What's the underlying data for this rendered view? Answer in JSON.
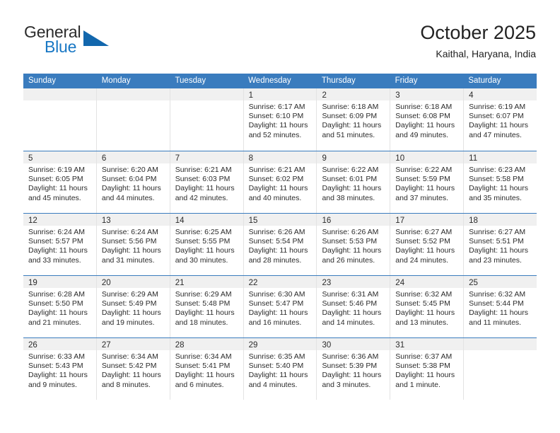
{
  "brand": {
    "name_part1": "General",
    "name_part2": "Blue",
    "triangle_color": "#1267ad",
    "blue_color": "#1877c4"
  },
  "header": {
    "title": "October 2025",
    "subtitle": "Kaithal, Haryana, India"
  },
  "theme": {
    "header_row_bg": "#3a7cbe",
    "daynum_strip_bg": "#f0f0f0",
    "cell_border": "#e3e3e3",
    "week_separator": "#3a7cbe"
  },
  "day_headers": [
    "Sunday",
    "Monday",
    "Tuesday",
    "Wednesday",
    "Thursday",
    "Friday",
    "Saturday"
  ],
  "weeks": [
    [
      {
        "day": "",
        "empty": true,
        "sunrise": "",
        "sunset": "",
        "daylight1": "",
        "daylight2": ""
      },
      {
        "day": "",
        "empty": true,
        "sunrise": "",
        "sunset": "",
        "daylight1": "",
        "daylight2": ""
      },
      {
        "day": "",
        "empty": true,
        "sunrise": "",
        "sunset": "",
        "daylight1": "",
        "daylight2": ""
      },
      {
        "day": "1",
        "empty": false,
        "sunrise": "Sunrise: 6:17 AM",
        "sunset": "Sunset: 6:10 PM",
        "daylight1": "Daylight: 11 hours",
        "daylight2": "and 52 minutes."
      },
      {
        "day": "2",
        "empty": false,
        "sunrise": "Sunrise: 6:18 AM",
        "sunset": "Sunset: 6:09 PM",
        "daylight1": "Daylight: 11 hours",
        "daylight2": "and 51 minutes."
      },
      {
        "day": "3",
        "empty": false,
        "sunrise": "Sunrise: 6:18 AM",
        "sunset": "Sunset: 6:08 PM",
        "daylight1": "Daylight: 11 hours",
        "daylight2": "and 49 minutes."
      },
      {
        "day": "4",
        "empty": false,
        "sunrise": "Sunrise: 6:19 AM",
        "sunset": "Sunset: 6:07 PM",
        "daylight1": "Daylight: 11 hours",
        "daylight2": "and 47 minutes."
      }
    ],
    [
      {
        "day": "5",
        "empty": false,
        "sunrise": "Sunrise: 6:19 AM",
        "sunset": "Sunset: 6:05 PM",
        "daylight1": "Daylight: 11 hours",
        "daylight2": "and 45 minutes."
      },
      {
        "day": "6",
        "empty": false,
        "sunrise": "Sunrise: 6:20 AM",
        "sunset": "Sunset: 6:04 PM",
        "daylight1": "Daylight: 11 hours",
        "daylight2": "and 44 minutes."
      },
      {
        "day": "7",
        "empty": false,
        "sunrise": "Sunrise: 6:21 AM",
        "sunset": "Sunset: 6:03 PM",
        "daylight1": "Daylight: 11 hours",
        "daylight2": "and 42 minutes."
      },
      {
        "day": "8",
        "empty": false,
        "sunrise": "Sunrise: 6:21 AM",
        "sunset": "Sunset: 6:02 PM",
        "daylight1": "Daylight: 11 hours",
        "daylight2": "and 40 minutes."
      },
      {
        "day": "9",
        "empty": false,
        "sunrise": "Sunrise: 6:22 AM",
        "sunset": "Sunset: 6:01 PM",
        "daylight1": "Daylight: 11 hours",
        "daylight2": "and 38 minutes."
      },
      {
        "day": "10",
        "empty": false,
        "sunrise": "Sunrise: 6:22 AM",
        "sunset": "Sunset: 5:59 PM",
        "daylight1": "Daylight: 11 hours",
        "daylight2": "and 37 minutes."
      },
      {
        "day": "11",
        "empty": false,
        "sunrise": "Sunrise: 6:23 AM",
        "sunset": "Sunset: 5:58 PM",
        "daylight1": "Daylight: 11 hours",
        "daylight2": "and 35 minutes."
      }
    ],
    [
      {
        "day": "12",
        "empty": false,
        "sunrise": "Sunrise: 6:24 AM",
        "sunset": "Sunset: 5:57 PM",
        "daylight1": "Daylight: 11 hours",
        "daylight2": "and 33 minutes."
      },
      {
        "day": "13",
        "empty": false,
        "sunrise": "Sunrise: 6:24 AM",
        "sunset": "Sunset: 5:56 PM",
        "daylight1": "Daylight: 11 hours",
        "daylight2": "and 31 minutes."
      },
      {
        "day": "14",
        "empty": false,
        "sunrise": "Sunrise: 6:25 AM",
        "sunset": "Sunset: 5:55 PM",
        "daylight1": "Daylight: 11 hours",
        "daylight2": "and 30 minutes."
      },
      {
        "day": "15",
        "empty": false,
        "sunrise": "Sunrise: 6:26 AM",
        "sunset": "Sunset: 5:54 PM",
        "daylight1": "Daylight: 11 hours",
        "daylight2": "and 28 minutes."
      },
      {
        "day": "16",
        "empty": false,
        "sunrise": "Sunrise: 6:26 AM",
        "sunset": "Sunset: 5:53 PM",
        "daylight1": "Daylight: 11 hours",
        "daylight2": "and 26 minutes."
      },
      {
        "day": "17",
        "empty": false,
        "sunrise": "Sunrise: 6:27 AM",
        "sunset": "Sunset: 5:52 PM",
        "daylight1": "Daylight: 11 hours",
        "daylight2": "and 24 minutes."
      },
      {
        "day": "18",
        "empty": false,
        "sunrise": "Sunrise: 6:27 AM",
        "sunset": "Sunset: 5:51 PM",
        "daylight1": "Daylight: 11 hours",
        "daylight2": "and 23 minutes."
      }
    ],
    [
      {
        "day": "19",
        "empty": false,
        "sunrise": "Sunrise: 6:28 AM",
        "sunset": "Sunset: 5:50 PM",
        "daylight1": "Daylight: 11 hours",
        "daylight2": "and 21 minutes."
      },
      {
        "day": "20",
        "empty": false,
        "sunrise": "Sunrise: 6:29 AM",
        "sunset": "Sunset: 5:49 PM",
        "daylight1": "Daylight: 11 hours",
        "daylight2": "and 19 minutes."
      },
      {
        "day": "21",
        "empty": false,
        "sunrise": "Sunrise: 6:29 AM",
        "sunset": "Sunset: 5:48 PM",
        "daylight1": "Daylight: 11 hours",
        "daylight2": "and 18 minutes."
      },
      {
        "day": "22",
        "empty": false,
        "sunrise": "Sunrise: 6:30 AM",
        "sunset": "Sunset: 5:47 PM",
        "daylight1": "Daylight: 11 hours",
        "daylight2": "and 16 minutes."
      },
      {
        "day": "23",
        "empty": false,
        "sunrise": "Sunrise: 6:31 AM",
        "sunset": "Sunset: 5:46 PM",
        "daylight1": "Daylight: 11 hours",
        "daylight2": "and 14 minutes."
      },
      {
        "day": "24",
        "empty": false,
        "sunrise": "Sunrise: 6:32 AM",
        "sunset": "Sunset: 5:45 PM",
        "daylight1": "Daylight: 11 hours",
        "daylight2": "and 13 minutes."
      },
      {
        "day": "25",
        "empty": false,
        "sunrise": "Sunrise: 6:32 AM",
        "sunset": "Sunset: 5:44 PM",
        "daylight1": "Daylight: 11 hours",
        "daylight2": "and 11 minutes."
      }
    ],
    [
      {
        "day": "26",
        "empty": false,
        "sunrise": "Sunrise: 6:33 AM",
        "sunset": "Sunset: 5:43 PM",
        "daylight1": "Daylight: 11 hours",
        "daylight2": "and 9 minutes."
      },
      {
        "day": "27",
        "empty": false,
        "sunrise": "Sunrise: 6:34 AM",
        "sunset": "Sunset: 5:42 PM",
        "daylight1": "Daylight: 11 hours",
        "daylight2": "and 8 minutes."
      },
      {
        "day": "28",
        "empty": false,
        "sunrise": "Sunrise: 6:34 AM",
        "sunset": "Sunset: 5:41 PM",
        "daylight1": "Daylight: 11 hours",
        "daylight2": "and 6 minutes."
      },
      {
        "day": "29",
        "empty": false,
        "sunrise": "Sunrise: 6:35 AM",
        "sunset": "Sunset: 5:40 PM",
        "daylight1": "Daylight: 11 hours",
        "daylight2": "and 4 minutes."
      },
      {
        "day": "30",
        "empty": false,
        "sunrise": "Sunrise: 6:36 AM",
        "sunset": "Sunset: 5:39 PM",
        "daylight1": "Daylight: 11 hours",
        "daylight2": "and 3 minutes."
      },
      {
        "day": "31",
        "empty": false,
        "sunrise": "Sunrise: 6:37 AM",
        "sunset": "Sunset: 5:38 PM",
        "daylight1": "Daylight: 11 hours",
        "daylight2": "and 1 minute."
      },
      {
        "day": "",
        "empty": true,
        "sunrise": "",
        "sunset": "",
        "daylight1": "",
        "daylight2": ""
      }
    ]
  ]
}
